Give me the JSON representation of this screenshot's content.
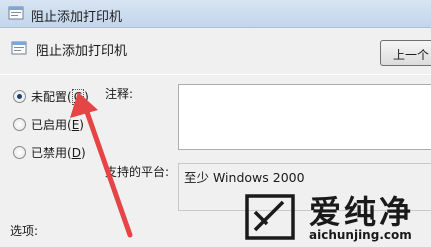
{
  "window": {
    "title": "阻止添加打印机"
  },
  "header": {
    "policy_name": "阻止添加打印机",
    "prev_button": "上一个"
  },
  "state": {
    "options": [
      {
        "label_before": "未配置(",
        "key": "C",
        "label_after": ")",
        "checked": true
      },
      {
        "label_before": "已启用(",
        "key": "E",
        "label_after": ")",
        "checked": false
      },
      {
        "label_before": "已禁用(",
        "key": "D",
        "label_after": ")",
        "checked": false
      }
    ]
  },
  "comment": {
    "label": "注释:",
    "value": ""
  },
  "platform": {
    "label": "支持的平台:",
    "value": "至少 Windows 2000"
  },
  "options_section": {
    "label": "选项:"
  },
  "watermark": {
    "brand_text": "爱纯净",
    "domain_text": "aichunjing.com"
  },
  "colors": {
    "annotation_arrow": "#e64545",
    "watermark": "#1a1a1a"
  }
}
